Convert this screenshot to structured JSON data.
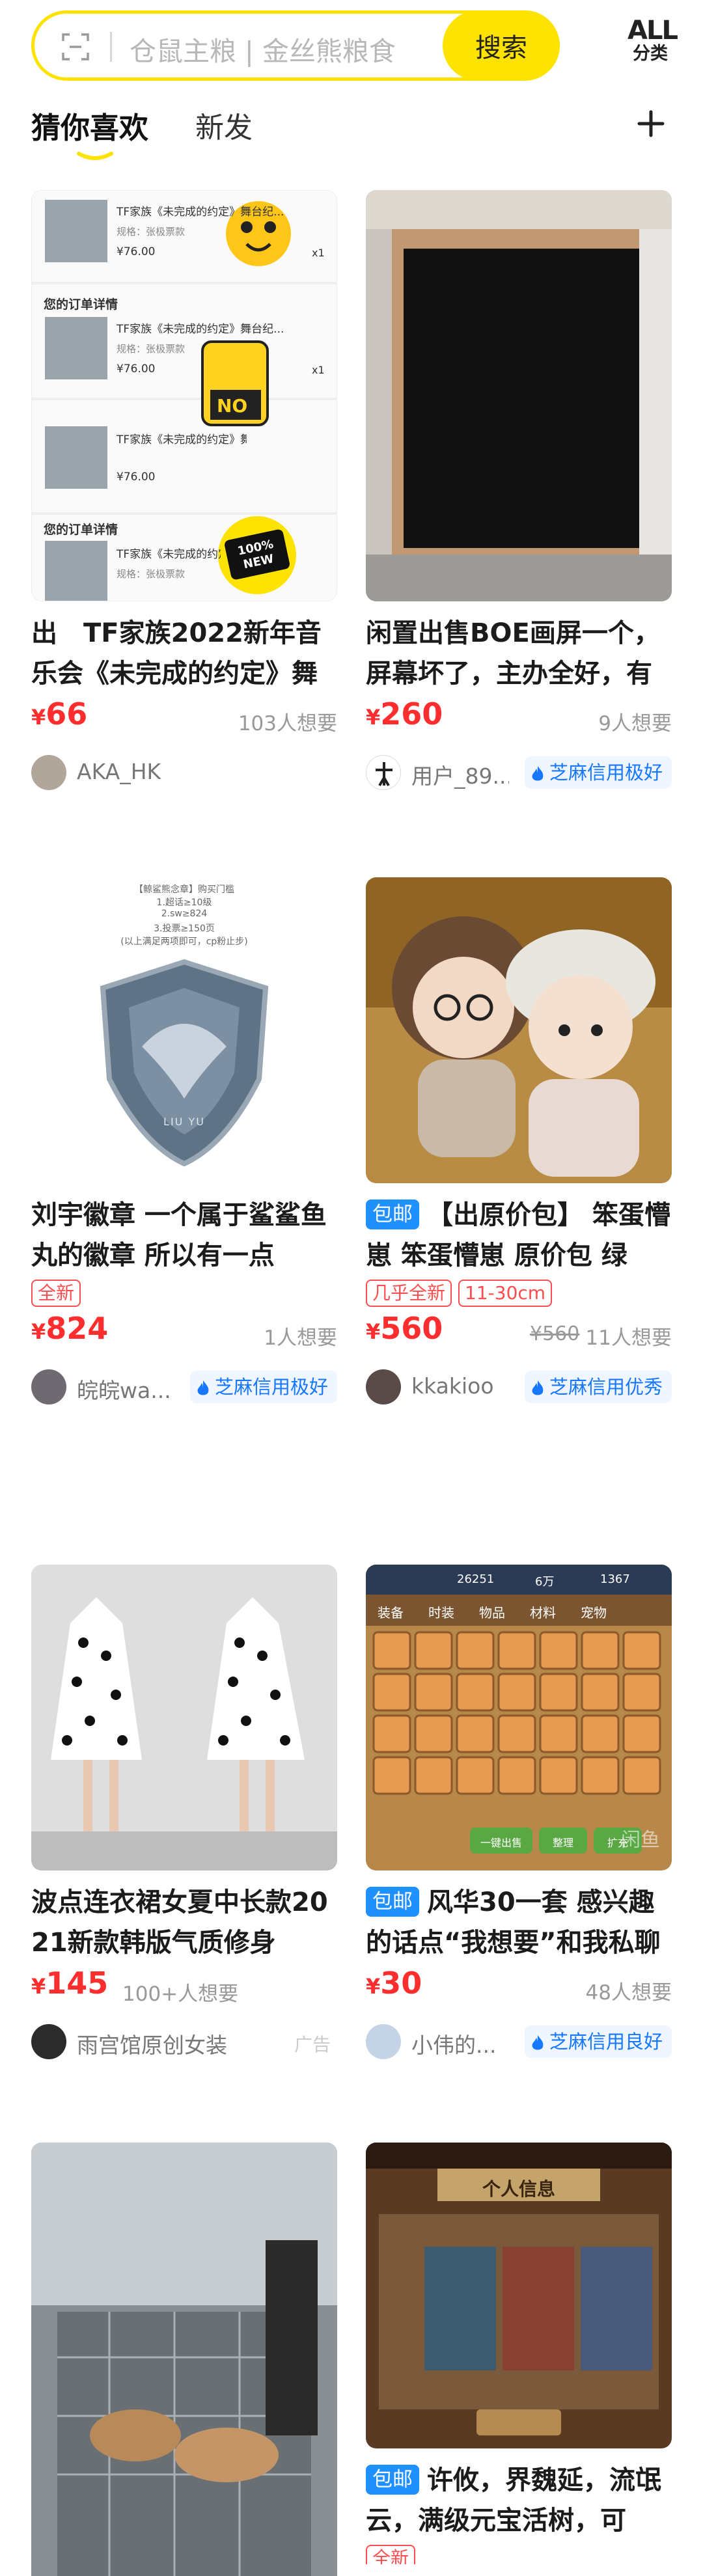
{
  "header": {
    "search_placeholder": "仓鼠主粮 | 金丝熊粮食",
    "search_button": "搜索",
    "all_category_line1": "ALL",
    "all_category_line2": "分类"
  },
  "tabs": [
    {
      "label": "猜你喜欢",
      "active": true
    },
    {
      "label": "新发",
      "active": false
    }
  ],
  "items": [
    {
      "title": "出　TF家族2022新年音乐会《未完成的约定》舞",
      "price_symbol": "¥",
      "price": "66",
      "want": "103人想要",
      "seller": "AKA_HK",
      "receipt": {
        "section_title": "您的订单详情",
        "product_line": "TF家族《未完成的约定》舞台纪...",
        "spec_line": "规格：张极票款",
        "price_line": "¥76.00",
        "qty": "x1",
        "sticker_no": "NO",
        "sticker_new": "100% NEW"
      }
    },
    {
      "title": "闲置出售BOE画屏一个，屏幕坏了，主办全好，有",
      "price_symbol": "¥",
      "price": "260",
      "want": "9人想要",
      "seller": "用户_89...",
      "credit": "芝麻信用极好"
    },
    {
      "title": "刘宇徽章 一个属于鲨鲨鱼丸的徽章 所以有一点",
      "tags": [
        "全新"
      ],
      "price_symbol": "¥",
      "price": "824",
      "want": "1人想要",
      "seller": "皖皖wa...",
      "credit": "芝麻信用极好",
      "badge_note": [
        "【鲸鲨熊念章】购买门槛",
        "1.超话≥10级",
        "2.sw≥824",
        "3.投票≥150页",
        "(以上满足两项即可，cp粉止步)"
      ],
      "badge_text": "LIU YU"
    },
    {
      "badge": "包邮",
      "title": "【出原价包】 笨蛋懵崽 笨蛋懵崽 原价包 绿",
      "tags": [
        "几乎全新",
        "11-30cm"
      ],
      "price_symbol": "¥",
      "price": "560",
      "original_price": "¥560",
      "want": "11人想要",
      "seller": "kkakioo",
      "credit": "芝麻信用优秀"
    },
    {
      "title": "波点连衣裙女夏中长款2021新款韩版气质修身",
      "price_symbol": "¥",
      "price": "145",
      "want": "100+人想要",
      "seller": "雨宫馆原创女装",
      "ad": "广告"
    },
    {
      "badge": "包邮",
      "title": "风华30一套 感兴趣的话点“我想要”和我私聊",
      "price_symbol": "¥",
      "price": "30",
      "want": "48人想要",
      "seller": "小伟的...",
      "credit": "芝麻信用良好",
      "game_tabs": [
        "装备",
        "时装",
        "物品",
        "材料",
        "宠物"
      ],
      "game_stats": [
        "26251",
        "6万",
        "1367"
      ],
      "game_buttons": [
        "一键出售",
        "整理",
        "扩充"
      ],
      "watermark": "闲鱼"
    },
    {
      "title": "",
      "price": ""
    },
    {
      "badge": "包邮",
      "title": "许攸，界魏延，流氓云，满级元宝活树，可",
      "tags": [
        "全新"
      ],
      "game_title": "个人信息"
    }
  ],
  "colors": {
    "brand_yellow": "#ffe300",
    "price_red": "#ff2e2e",
    "credit_blue": "#1677ff"
  }
}
